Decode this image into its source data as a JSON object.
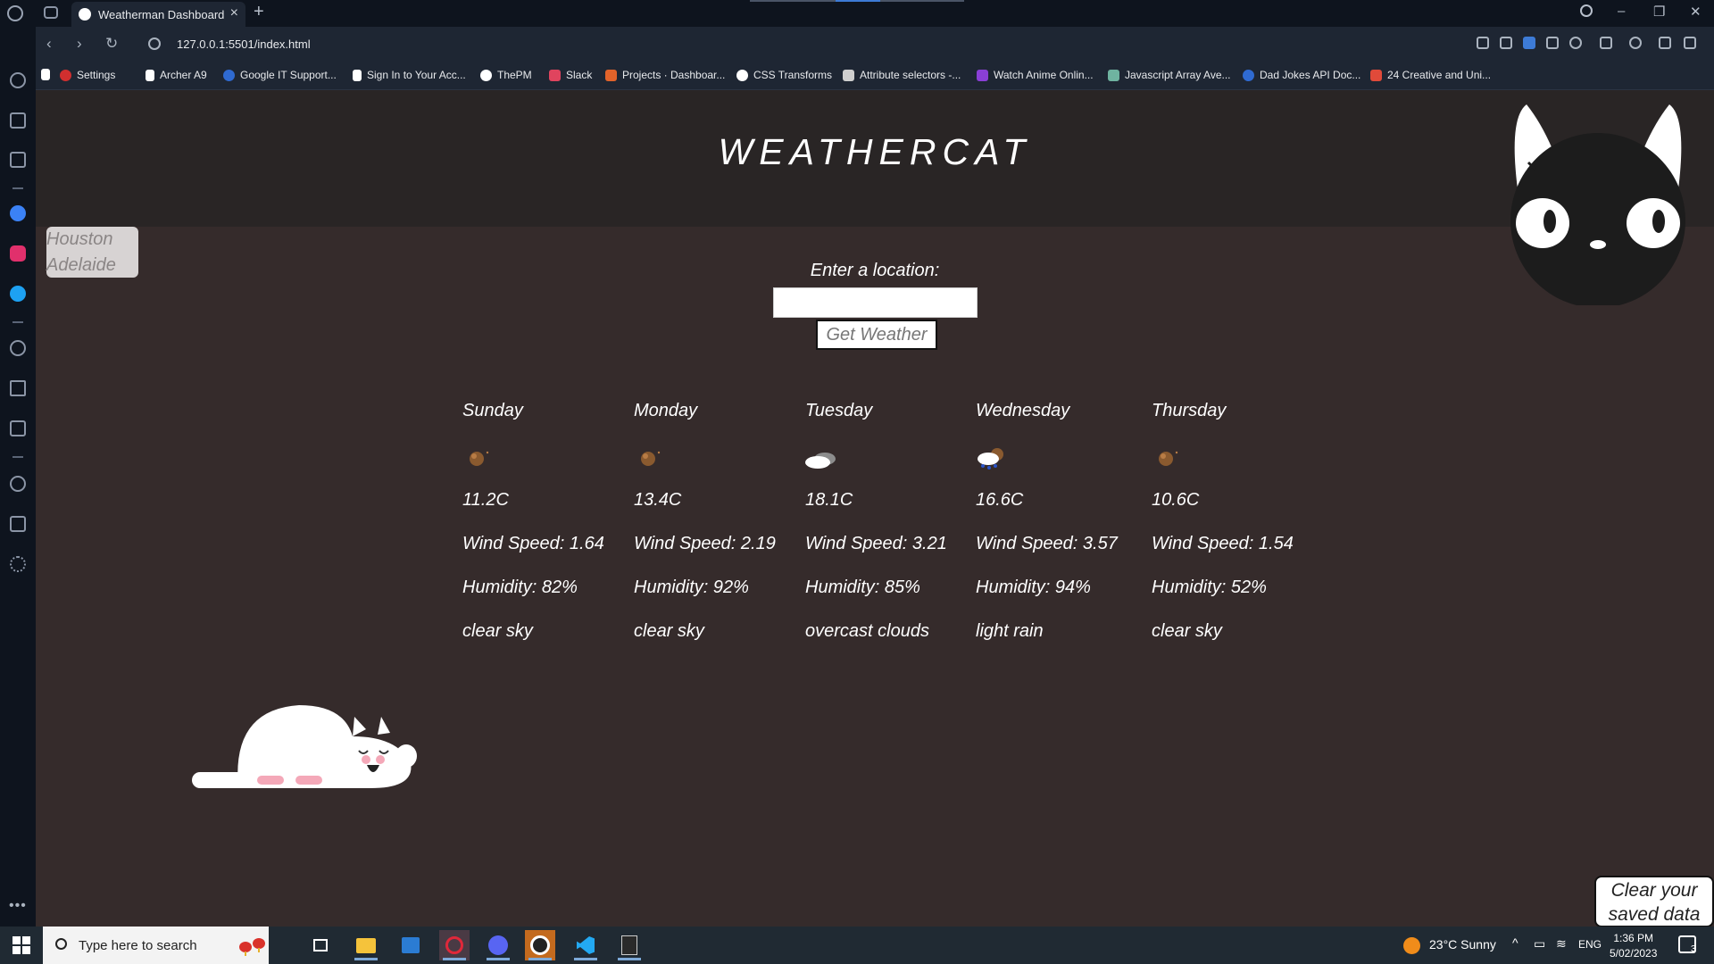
{
  "browser": {
    "tab_title": "Weatherman Dashboard",
    "url": "127.0.0.1:5501/index.html",
    "bookmarks": [
      {
        "label": "Settings",
        "color": "#d12f2f"
      },
      {
        "label": "Archer A9",
        "color": "#ffffff"
      },
      {
        "label": "Google IT Support...",
        "color": "#2f6ad1"
      },
      {
        "label": "Sign In to Your Acc...",
        "color": "#ffffff"
      },
      {
        "label": "ThePM",
        "color": "#ffffff"
      },
      {
        "label": "Slack",
        "color": "#e0445e"
      },
      {
        "label": "Projects · Dashboar...",
        "color": "#e2632a"
      },
      {
        "label": "CSS Transforms",
        "color": "#ffffff"
      },
      {
        "label": "Attribute selectors -...",
        "color": "#cfcfcf"
      },
      {
        "label": "Watch Anime Onlin...",
        "color": "#8a3fd6"
      },
      {
        "label": "Javascript Array Ave...",
        "color": "#6fb3a0"
      },
      {
        "label": "Dad Jokes API Doc...",
        "color": "#2f6ad1"
      },
      {
        "label": "24 Creative and Uni...",
        "color": "#e04a3a"
      }
    ]
  },
  "app": {
    "title": "WEATHERCAT",
    "saved_locations": [
      "Houston",
      "Adelaide"
    ],
    "location_label": "Enter a location:",
    "location_value": "",
    "get_weather_label": "Get Weather",
    "clear_label": "Clear your saved data",
    "forecast": [
      {
        "day": "Sunday",
        "icon": "clear-sky-night-icon",
        "temp": "11.2C",
        "wind": "Wind Speed: 1.64",
        "humidity": "Humidity: 82%",
        "desc": "clear sky"
      },
      {
        "day": "Monday",
        "icon": "clear-sky-night-icon",
        "temp": "13.4C",
        "wind": "Wind Speed: 2.19",
        "humidity": "Humidity: 92%",
        "desc": "clear sky"
      },
      {
        "day": "Tuesday",
        "icon": "overcast-clouds-icon",
        "temp": "18.1C",
        "wind": "Wind Speed: 3.21",
        "humidity": "Humidity: 85%",
        "desc": "overcast clouds"
      },
      {
        "day": "Wednesday",
        "icon": "light-rain-icon",
        "temp": "16.6C",
        "wind": "Wind Speed: 3.57",
        "humidity": "Humidity: 94%",
        "desc": "light rain"
      },
      {
        "day": "Thursday",
        "icon": "clear-sky-night-icon",
        "temp": "10.6C",
        "wind": "Wind Speed: 1.54",
        "humidity": "Humidity: 52%",
        "desc": "clear sky"
      }
    ]
  },
  "taskbar": {
    "search_placeholder": "Type here to search",
    "weather": "23°C  Sunny",
    "language": "ENG",
    "time": "1:36 PM",
    "date": "5/02/2023",
    "notifications": "3"
  },
  "colors": {
    "page_bg": "#352b2b",
    "header_bg": "#292525",
    "accent": "#ffffff"
  }
}
